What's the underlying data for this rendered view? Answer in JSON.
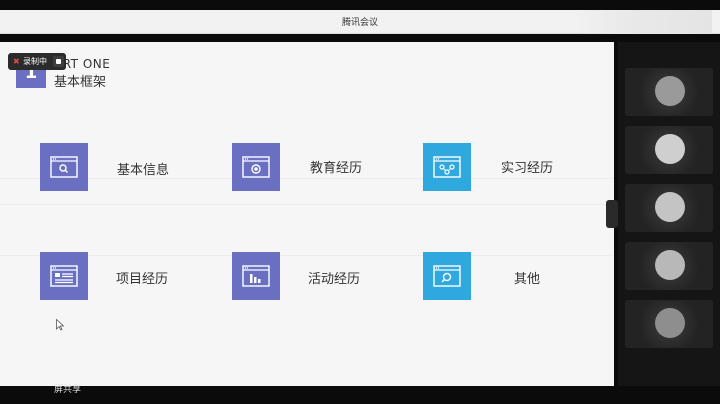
{
  "window": {
    "title": "腾讯会议"
  },
  "recording": {
    "label": "录制中"
  },
  "slide": {
    "badge_number": "1",
    "part_label": "ART ONE",
    "section_title": "基本框架",
    "tiles": [
      {
        "label": "基本信息",
        "icon": "search-window-icon",
        "color": "#6a6fc1"
      },
      {
        "label": "教育经历",
        "icon": "record-window-icon",
        "color": "#6a6fc1"
      },
      {
        "label": "实习经历",
        "icon": "network-window-icon",
        "color": "#2ea8df"
      },
      {
        "label": "项目经历",
        "icon": "document-window-icon",
        "color": "#6a6fc1"
      },
      {
        "label": "活动经历",
        "icon": "chart-window-icon",
        "color": "#6a6fc1"
      },
      {
        "label": "其他",
        "icon": "search-window-icon",
        "color": "#2ea8df"
      }
    ]
  },
  "share": {
    "label": "屏共享"
  }
}
